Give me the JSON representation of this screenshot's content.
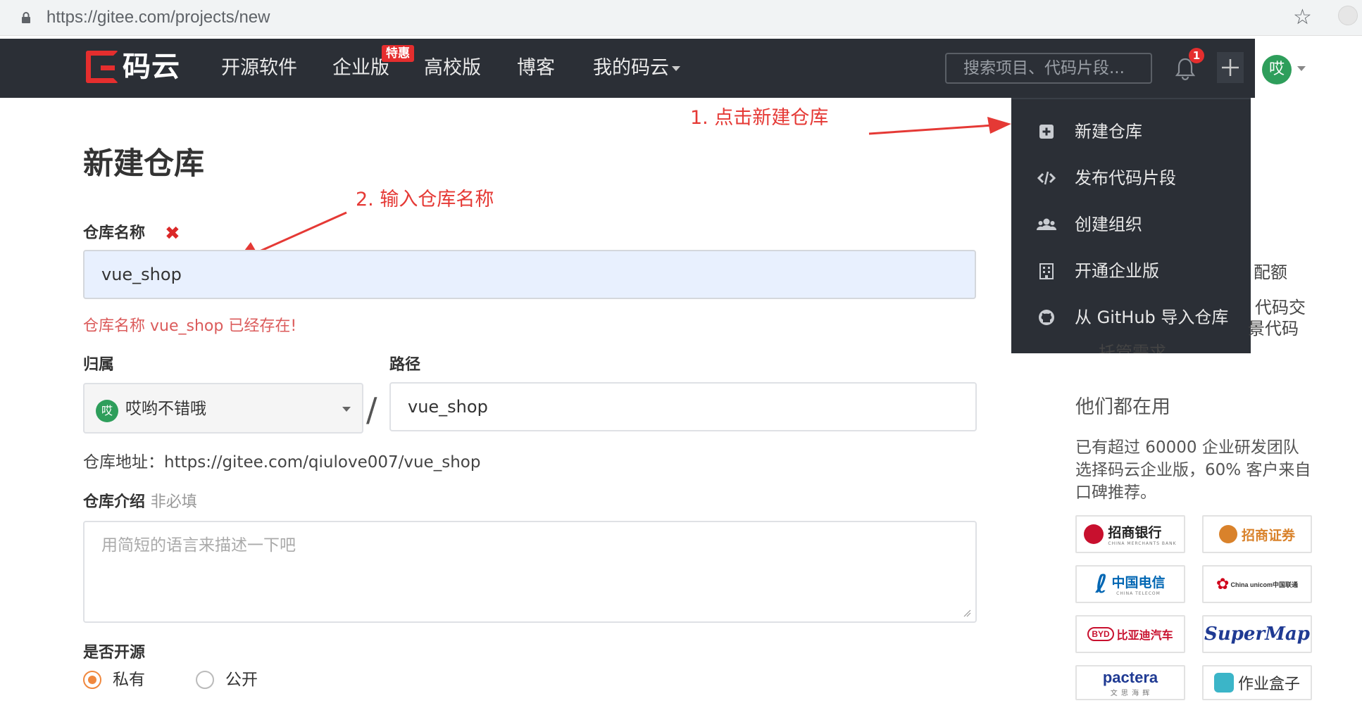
{
  "browser": {
    "url": "https://gitee.com/projects/new"
  },
  "nav": {
    "logo_text": "码云",
    "items": [
      "开源软件",
      "企业版",
      "高校版",
      "博客",
      "我的码云"
    ],
    "enterprise_badge": "特惠",
    "search_placeholder": "搜索项目、代码片段...",
    "notification_count": "1",
    "avatar_char": "哎"
  },
  "dropdown": {
    "items": [
      {
        "label": "新建仓库",
        "icon": "plus-square-icon"
      },
      {
        "label": "发布代码片段",
        "icon": "code-icon"
      },
      {
        "label": "创建组织",
        "icon": "users-icon"
      },
      {
        "label": "开通企业版",
        "icon": "building-icon"
      },
      {
        "label": "从 GitHub 导入仓库",
        "icon": "github-icon"
      }
    ]
  },
  "annotations": {
    "step1": "1. 点击新建仓库",
    "step2": "2. 输入仓库名称"
  },
  "form": {
    "title": "新建仓库",
    "repo_name_label": "仓库名称",
    "repo_name_value": "vue_shop",
    "repo_name_error": "仓库名称 vue_shop 已经存在!",
    "owner_label": "归属",
    "owner_avatar_char": "哎",
    "owner_value": "哎哟不错哦",
    "path_label": "路径",
    "path_value": "vue_shop",
    "repo_url": "仓库地址：https://gitee.com/qiulove007/vue_shop",
    "desc_label": "仓库介绍",
    "desc_optional": "非必填",
    "desc_placeholder": "用简短的语言来描述一下吧",
    "visibility_label": "是否开源",
    "visibility_options": [
      "私有",
      "公开"
    ],
    "visibility_selected": "私有"
  },
  "sidebar": {
    "partial_1": "配额",
    "partial_2": "代码交",
    "partial_3": "景代码",
    "partial_4": "托管需求",
    "heading": "他们都在用",
    "text": "已有超过 60000 企业研发团队选择码云企业版，60% 客户来自口碑推荐。",
    "customer_logos": [
      {
        "name": "招商银行",
        "sub": "CHINA MERCHANTS BANK",
        "color": "#c8102e"
      },
      {
        "name": "招商证券",
        "sub": "",
        "color": "#d9822b"
      },
      {
        "name": "中国电信",
        "sub": "CHINA TELECOM",
        "color": "#0066b3"
      },
      {
        "name": "China unicom中国联通",
        "sub": "",
        "color": "#d0021b"
      },
      {
        "name": "比亚迪汽车",
        "sub": "",
        "color": "#c8102e"
      },
      {
        "name": "SuperMap",
        "sub": "",
        "color": "#1f3a93"
      },
      {
        "name": "pactera",
        "sub": "文 思 海 辉",
        "color": "#1f3a93"
      },
      {
        "name": "作业盒子",
        "sub": "",
        "color": "#333333"
      }
    ]
  }
}
